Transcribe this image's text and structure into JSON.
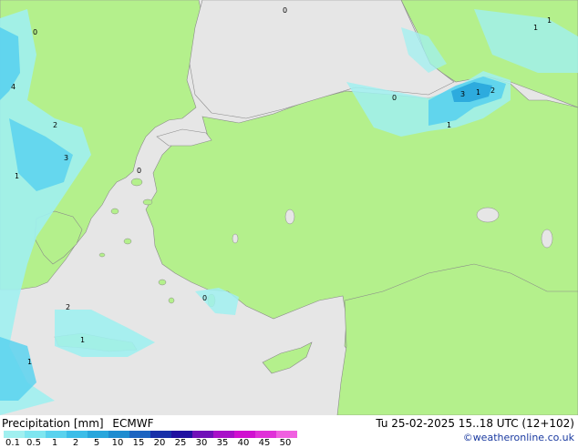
{
  "legend": {
    "title": "Precipitation [mm]",
    "model": "ECMWF",
    "valid_time": "Tu 25-02-2025 15..18 UTC (12+102)",
    "copyright": "©weatheronline.co.uk",
    "ticks": [
      "0.1",
      "0.5",
      "1",
      "2",
      "5",
      "10",
      "15",
      "20",
      "25",
      "30",
      "35",
      "40",
      "45",
      "50"
    ],
    "colors": [
      "#a0f0f0",
      "#7ee6f0",
      "#5ad2ee",
      "#3cbde8",
      "#28a6dc",
      "#1e8cd0",
      "#1c64c0",
      "#1830a8",
      "#2010a0",
      "#7010b8",
      "#a810c8",
      "#d010d0",
      "#e030d8",
      "#f060e0"
    ]
  },
  "map": {
    "land_color": "#b4f08c",
    "sea_color": "#e6e6e6",
    "precip_light": "#a0f0f0",
    "precip_medium": "#5ad2ee",
    "precip_heavy": "#28a6dc",
    "value_labels": [
      "0",
      "1",
      "2",
      "3",
      "4",
      "1",
      "2",
      "0",
      "1",
      "3",
      "1",
      "2",
      "0",
      "1",
      "0",
      "0",
      "1",
      "1"
    ]
  }
}
